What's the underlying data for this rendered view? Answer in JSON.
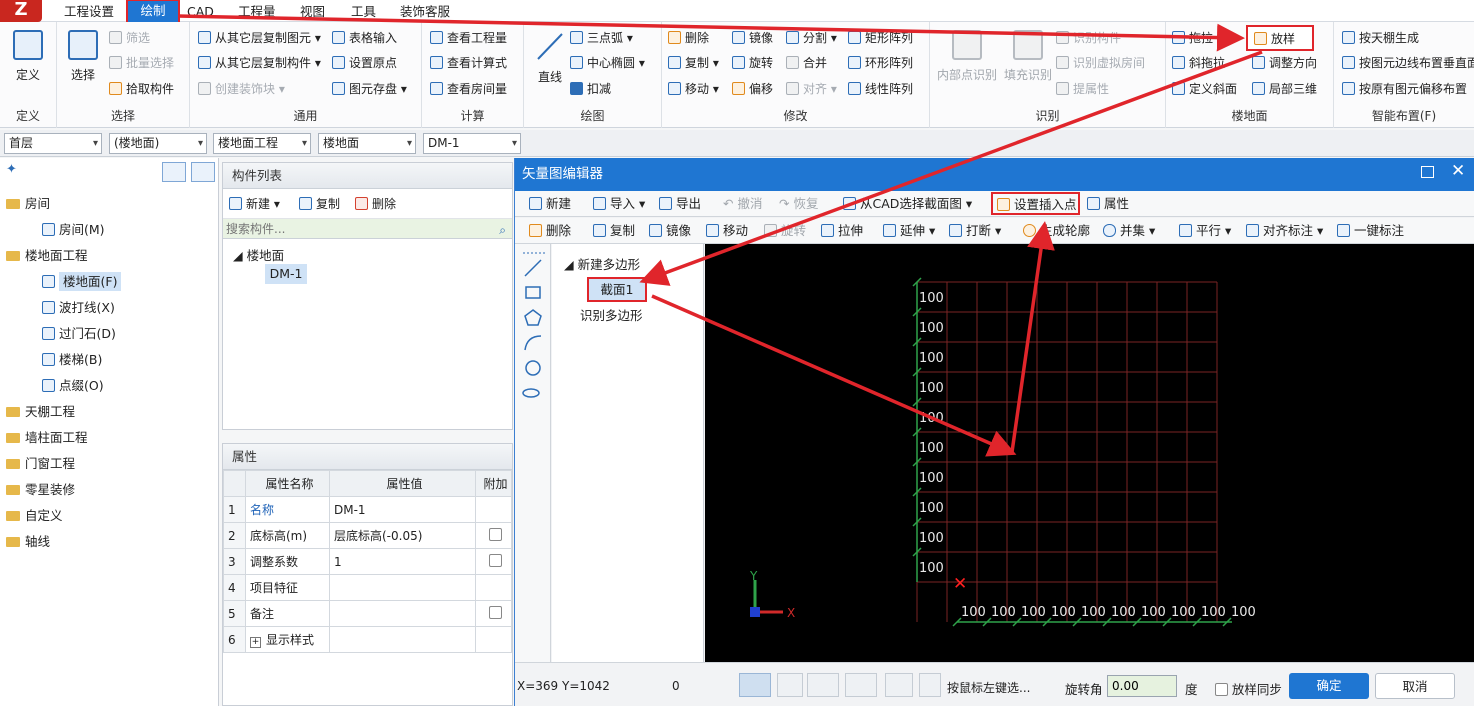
{
  "menubar": {
    "tabs": [
      "工程设置",
      "绘制",
      "CAD",
      "工程量",
      "视图",
      "工具",
      "装饰客服"
    ]
  },
  "ribbon": {
    "define": {
      "label": "定义",
      "group": "定义"
    },
    "select": {
      "label": "选择",
      "group": "选择",
      "items": [
        "筛选",
        "批量选择",
        "拾取构件"
      ]
    },
    "general": {
      "group": "通用",
      "items": [
        "从其它层复制图元",
        "从其它层复制构件",
        "创建装饰块",
        "表格输入",
        "设置原点",
        "图元存盘"
      ]
    },
    "calc": {
      "group": "计算",
      "items": [
        "查看工程量",
        "查看计算式",
        "查看房间量"
      ]
    },
    "draw": {
      "group": "绘图",
      "line": "直线",
      "items": [
        "三点弧",
        "中心椭圆",
        "扣减"
      ]
    },
    "modify": {
      "group": "修改",
      "items": [
        "删除",
        "复制",
        "移动",
        "镜像",
        "旋转",
        "偏移",
        "分割",
        "合并",
        "对齐",
        "矩形阵列",
        "环形阵列",
        "线性阵列"
      ]
    },
    "recognize": {
      "group": "识别",
      "items": [
        "内部点识别",
        "填充识别",
        "识别构件",
        "识别虚拟房间",
        "提属性"
      ]
    },
    "floor": {
      "group": "楼地面",
      "items": [
        "拖拉",
        "斜拖拉",
        "定义斜面",
        "放样",
        "调整方向",
        "局部三维"
      ]
    },
    "smart": {
      "group": "智能布置(F)",
      "items": [
        "按天棚生成",
        "按图元边线布置垂直面",
        "按原有图元偏移布置"
      ]
    }
  },
  "filters": [
    "首层",
    "(楼地面)",
    "楼地面工程",
    "楼地面",
    "DM-1"
  ],
  "tree": [
    {
      "label": "房间",
      "level": 0
    },
    {
      "label": "房间(M)",
      "level": 1
    },
    {
      "label": "楼地面工程",
      "level": 0
    },
    {
      "label": "楼地面(F)",
      "level": 1
    },
    {
      "label": "波打线(X)",
      "level": 1
    },
    {
      "label": "过门石(D)",
      "level": 1
    },
    {
      "label": "楼梯(B)",
      "level": 1
    },
    {
      "label": "点缀(O)",
      "level": 1
    },
    {
      "label": "天棚工程",
      "level": 0
    },
    {
      "label": "墙柱面工程",
      "level": 0
    },
    {
      "label": "门窗工程",
      "level": 0
    },
    {
      "label": "零星装修",
      "level": 0
    },
    {
      "label": "自定义",
      "level": 0
    },
    {
      "label": "轴线",
      "level": 0
    }
  ],
  "components": {
    "title": "构件列表",
    "new": "新建",
    "copy": "复制",
    "delete": "删除",
    "search_placeholder": "搜索构件...",
    "group": "楼地面",
    "item": "DM-1"
  },
  "properties": {
    "title": "属性",
    "headers": [
      "属性名称",
      "属性值",
      "附加"
    ],
    "rows": [
      {
        "no": "1",
        "name": "名称",
        "value": "DM-1",
        "check": false
      },
      {
        "no": "2",
        "name": "底标高(m)",
        "value": "层底标高(-0.05)",
        "check": true
      },
      {
        "no": "3",
        "name": "调整系数",
        "value": "1",
        "check": true
      },
      {
        "no": "4",
        "name": "项目特征",
        "value": "",
        "check": false
      },
      {
        "no": "5",
        "name": "备注",
        "value": "",
        "check": true
      },
      {
        "no": "6",
        "name": "显示样式",
        "value": "",
        "check": false
      }
    ]
  },
  "dialog": {
    "title": "矢量图编辑器",
    "toolbar1": [
      "新建",
      "导入",
      "导出",
      "撤消",
      "恢复",
      "从CAD选择截面图",
      "设置插入点",
      "属性"
    ],
    "toolbar2": [
      "删除",
      "复制",
      "镜像",
      "移动",
      "旋转",
      "拉伸",
      "延伸",
      "打断",
      "生成轮廓",
      "并集",
      "平行",
      "对齐标注",
      "一键标注"
    ],
    "tree": {
      "root": "新建多边形",
      "item": "截面1",
      "other": "识别多边形"
    },
    "grid_label": "100",
    "axis_x": "X",
    "axis_y": "Y",
    "status": {
      "coords": "X=369 Y=1042",
      "zero": "0",
      "hint": "按鼠标左键选...",
      "rotate_label": "旋转角",
      "rotate_value": "0.00",
      "degree": "度",
      "sync": "放样同步",
      "ok": "确定",
      "cancel": "取消"
    }
  },
  "colors": {
    "accent": "#1f76d2",
    "highlight": "#e0252b",
    "grid": "#8a2a2a"
  }
}
